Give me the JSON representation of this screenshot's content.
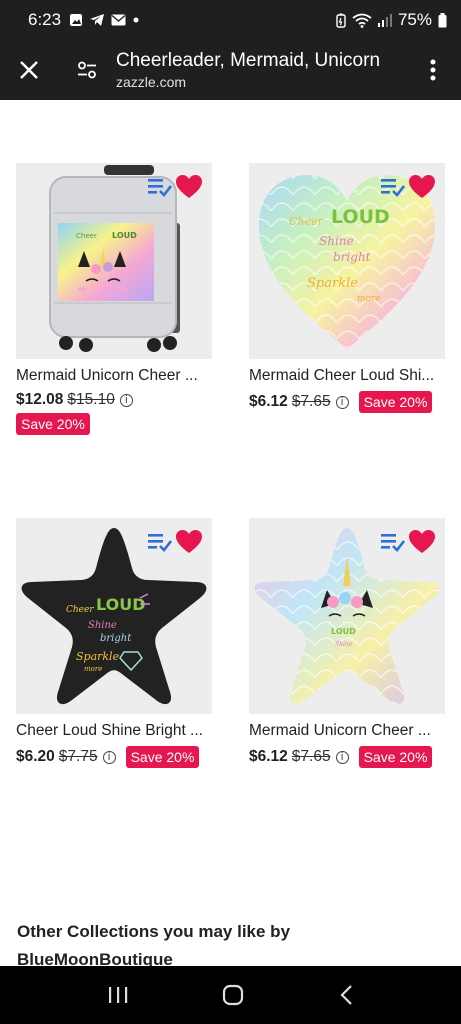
{
  "status_bar": {
    "time": "6:23",
    "battery": "75%"
  },
  "toolbar": {
    "title": "Cheerleader, Mermaid, Unicorn",
    "url": "zazzle.com"
  },
  "products": [
    {
      "name": "Mermaid Unicorn Cheer ...",
      "price": "$12.08",
      "original_price": "$15.10",
      "badge": "Save 20%",
      "info": "i"
    },
    {
      "name": "Mermaid Cheer Loud Shi...",
      "price": "$6.12",
      "original_price": "$7.65",
      "badge": "Save 20%",
      "info": "i"
    },
    {
      "name": "Cheer Loud Shine Bright ...",
      "price": "$6.20",
      "original_price": "$7.75",
      "badge": "Save 20%",
      "info": "i"
    },
    {
      "name": "Mermaid Unicorn Cheer ...",
      "price": "$6.12",
      "original_price": "$7.65",
      "badge": "Save 20%",
      "info": "i"
    }
  ],
  "artwork_text": {
    "cheer": "Cheer",
    "loud": "LOUD",
    "shine": "Shine",
    "bright": "bright",
    "sparkle": "Sparkle",
    "more": "more"
  },
  "collections_heading": "Other Collections you may like by BlueMoonBoutique",
  "colors": {
    "badge": "#e5174e",
    "heart": "#e5174e",
    "list_icon": "#2d6fd6",
    "bar": "#1e1f21"
  }
}
